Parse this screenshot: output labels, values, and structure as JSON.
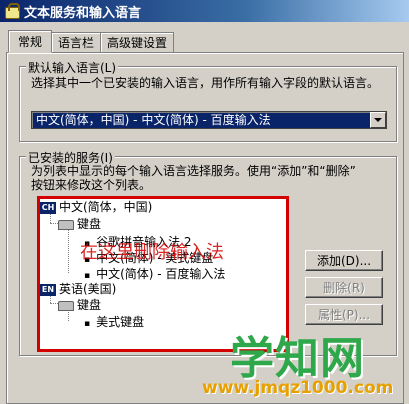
{
  "window": {
    "title": "文本服务和输入语言"
  },
  "tabs": [
    {
      "label": "常规"
    },
    {
      "label": "语言栏"
    },
    {
      "label": "高级键设置"
    }
  ],
  "default_language": {
    "group_title": "默认输入语言(L)",
    "description": "选择其中一个已安装的输入语言，用作所有输入字段的默认语言。",
    "selected_value": "中文(简体，中国) - 中文(简体) - 百度输入法"
  },
  "installed_services": {
    "group_title": "已安装的服务(I)",
    "description_line1": "为列表中显示的每个输入语言选择服务。使用“添加”和“删除”",
    "description_line2": "按钮来修改这个列表。",
    "tree": {
      "lang1": {
        "badge": "CH",
        "label": "中文(简体，中国)"
      },
      "lang1_keyboard": "键盘",
      "lang1_items": [
        "谷歌拼音输入法 2",
        "中文(简体) - 美式键盘",
        "中文(简体) - 百度输入法"
      ],
      "lang2": {
        "badge": "EN",
        "label": "英语(美国)"
      },
      "lang2_keyboard": "键盘",
      "lang2_items": [
        "美式键盘"
      ]
    },
    "annotation": "在这里删除输入法"
  },
  "buttons": {
    "add": "添加(D)...",
    "remove": "删除(R)",
    "properties": "属性(P)..."
  },
  "watermark": {
    "site_name": "学知网",
    "url": "www.jmqz1000.com"
  }
}
